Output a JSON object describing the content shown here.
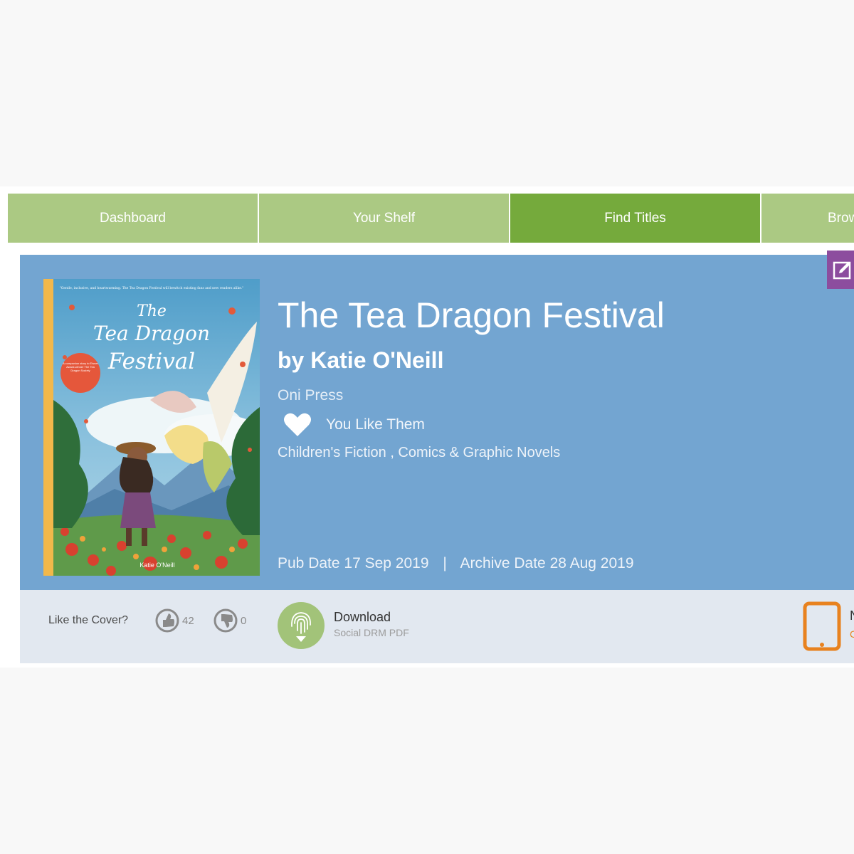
{
  "nav": {
    "tabs": [
      {
        "label": "Dashboard",
        "active": false
      },
      {
        "label": "Your Shelf",
        "active": false
      },
      {
        "label": "Find Titles",
        "active": true
      },
      {
        "label": "Brow",
        "active": false
      }
    ]
  },
  "book": {
    "title": "The Tea Dragon Festival",
    "author": "by Katie O'Neill",
    "publisher": "Oni Press",
    "like_text": "You Like Them",
    "categories": "Children's Fiction , Comics & Graphic Novels",
    "pub_date": "Pub Date 17 Sep 2019",
    "date_separator": "|",
    "archive_date": "Archive Date 28 Aug 2019",
    "cover": {
      "top_quote": "\"Gentle, inclusive, and heartwarming. The Tea Dragon Festival will bewitch existing fans and new readers alike.\"",
      "title_line1": "The",
      "title_line2": "Tea Dragon",
      "title_line3": "Festival",
      "badge_text": "A companion story to Eisner Award-winner The Tea Dragon Society",
      "author_line": "Katie O'Neill"
    }
  },
  "cover_rating": {
    "question": "Like the Cover?",
    "likes": "42",
    "dislikes": "0"
  },
  "download": {
    "label": "Download",
    "format": "Social DRM PDF"
  },
  "other_format": {
    "label": "N",
    "sub": "C"
  },
  "colors": {
    "nav_tab": "#abc983",
    "nav_active": "#75aa3c",
    "hero_bg": "#73a5d1",
    "bar_bg": "#e2e8f0",
    "edit_btn": "#8c4d9e",
    "download_green": "#a2c379",
    "tablet_orange": "#e8821f"
  },
  "icons": {
    "edit": "edit-pencil-icon",
    "heart": "heart-icon",
    "thumbs_up": "thumbs-up-icon",
    "thumbs_down": "thumbs-down-icon",
    "download": "fingerprint-download-icon",
    "tablet": "tablet-icon"
  }
}
